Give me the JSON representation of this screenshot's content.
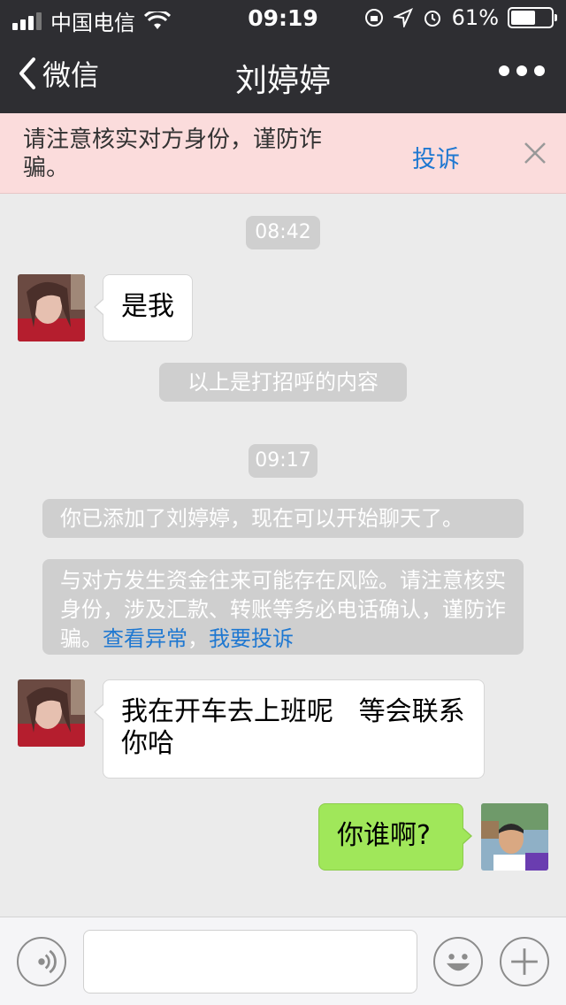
{
  "status_bar": {
    "carrier": "中国电信",
    "time": "09:19",
    "battery_percent": "61%",
    "battery_level": 0.61
  },
  "nav": {
    "back_label": "微信",
    "title": "刘婷婷"
  },
  "banner": {
    "warning_text": "请注意核实对方身份，谨防诈骗。",
    "complain_label": "投诉"
  },
  "chat": {
    "time_1": "08:42",
    "msg_1": "是我",
    "greeting_note": "以上是打招呼的内容",
    "time_2": "09:17",
    "added_note": "你已添加了刘婷婷，现在可以开始聊天了。",
    "risk_note": "与对方发生资金往来可能存在风险。请注意核实身份，涉及汇款、转账等务必电话确认，谨防诈骗。",
    "risk_link_1": "查看异常",
    "risk_sep": "，",
    "risk_link_2": "我要投诉",
    "msg_2": "我在开车去上班呢   等会联系你哈",
    "msg_3": "你谁啊?"
  },
  "icons": {
    "back": "chevron-left-icon",
    "more": "more-dots-icon",
    "close": "close-icon",
    "voice": "voice-icon",
    "emoji": "emoji-icon",
    "plus": "plus-icon"
  },
  "colors": {
    "nav_bg": "#2e2e32",
    "banner_bg": "#fbdcdc",
    "link": "#1f78d1",
    "my_bubble": "#a0e75a"
  }
}
